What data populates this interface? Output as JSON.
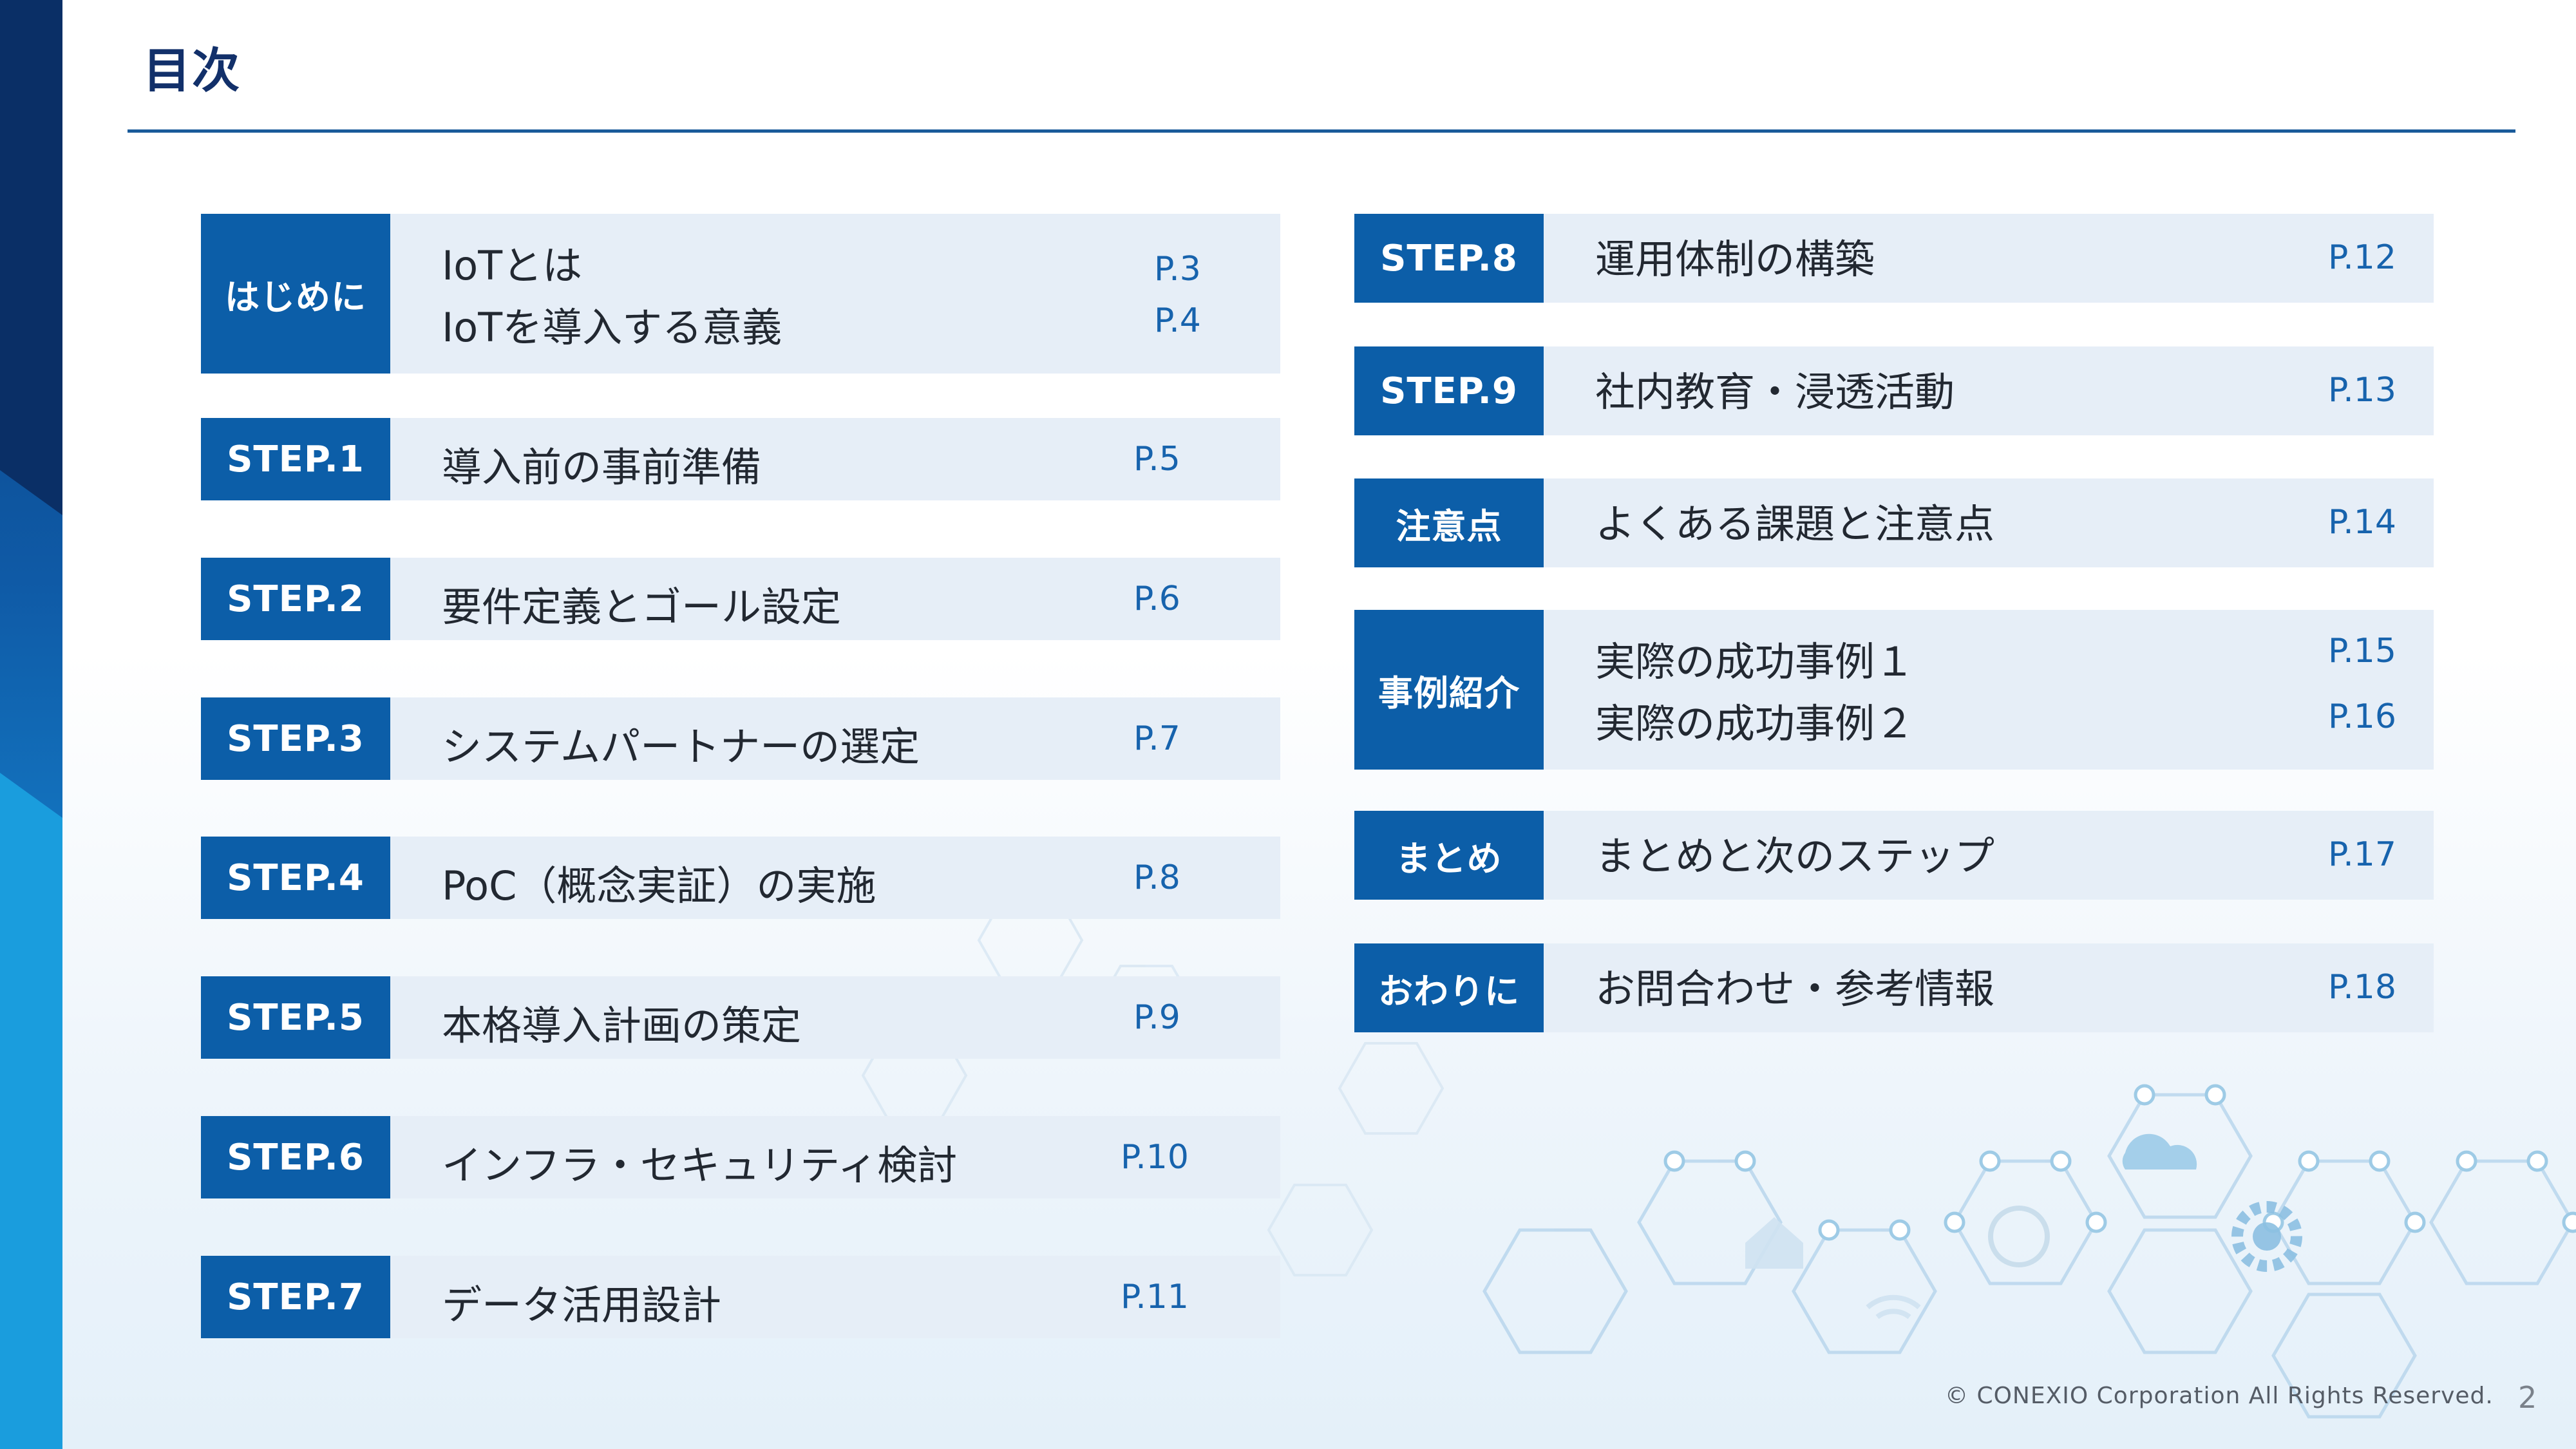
{
  "page": {
    "title": "目次",
    "number": "2"
  },
  "footer": {
    "copyright": "© CONEXIO Corporation All Rights Reserved."
  },
  "left_column": [
    {
      "badge": "はじめに",
      "items": [
        "IoTとは",
        "IoTを導入する意義"
      ],
      "pages": [
        "P.3",
        "P.4"
      ]
    },
    {
      "badge": "STEP.1",
      "items": [
        "導入前の事前準備"
      ],
      "pages": [
        "P.5"
      ]
    },
    {
      "badge": "STEP.2",
      "items": [
        "要件定義とゴール設定"
      ],
      "pages": [
        "P.6"
      ]
    },
    {
      "badge": "STEP.3",
      "items": [
        "システムパートナーの選定"
      ],
      "pages": [
        "P.7"
      ]
    },
    {
      "badge": "STEP.4",
      "items": [
        "PoC（概念実証）の実施"
      ],
      "pages": [
        "P.8"
      ]
    },
    {
      "badge": "STEP.5",
      "items": [
        "本格導入計画の策定"
      ],
      "pages": [
        "P.9"
      ]
    },
    {
      "badge": "STEP.6",
      "items": [
        "インフラ・セキュリティ検討"
      ],
      "pages": [
        "P.10"
      ]
    },
    {
      "badge": "STEP.7",
      "items": [
        "データ活用設計"
      ],
      "pages": [
        "P.11"
      ]
    }
  ],
  "right_column": [
    {
      "badge": "STEP.8",
      "items": [
        "運用体制の構築"
      ],
      "pages": [
        "P.12"
      ]
    },
    {
      "badge": "STEP.9",
      "items": [
        "社内教育・浸透活動"
      ],
      "pages": [
        "P.13"
      ]
    },
    {
      "badge": "注意点",
      "items": [
        "よくある課題と注意点"
      ],
      "pages": [
        "P.14"
      ]
    },
    {
      "badge": "事例紹介",
      "items": [
        "実際の成功事例１",
        "実際の成功事例２"
      ],
      "pages": [
        "P.15",
        "P.16"
      ]
    },
    {
      "badge": "まとめ",
      "items": [
        "まとめと次のステップ"
      ],
      "pages": [
        "P.17"
      ]
    },
    {
      "badge": "おわりに",
      "items": [
        "お問合わせ・参考情報"
      ],
      "pages": [
        "P.18"
      ]
    }
  ]
}
